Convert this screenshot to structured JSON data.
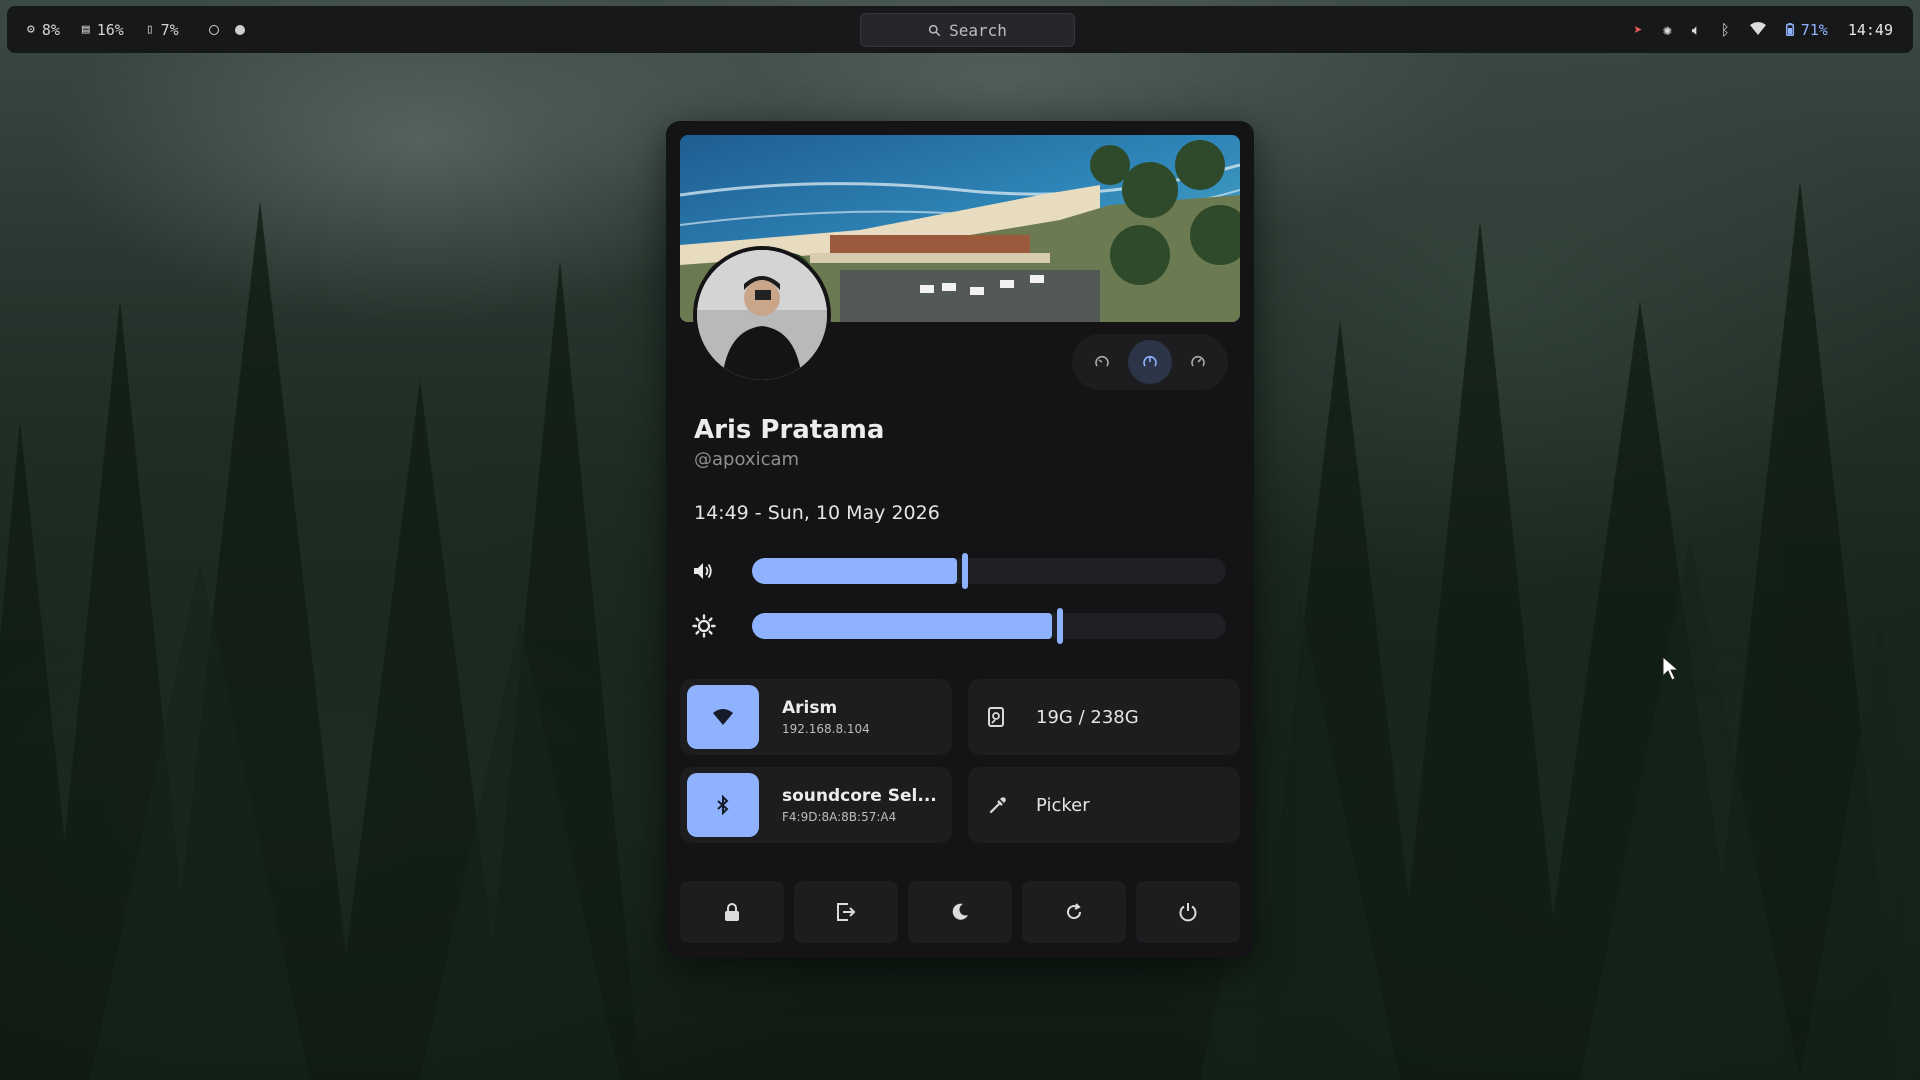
{
  "topbar": {
    "cpu": "8%",
    "ram": "16%",
    "disk": "7%",
    "search_label": "Search",
    "battery": "71%",
    "clock": "14:49"
  },
  "panel": {
    "user_name": "Aris Pratama",
    "user_handle": "@apoxicam",
    "datetime": "14:49 - Sun, 10 May 2026",
    "volume_level": 0.45,
    "brightness_level": 0.65,
    "wifi": {
      "name": "Arism",
      "detail": "192.168.8.104"
    },
    "storage": {
      "label": "19G / 238G"
    },
    "bluetooth": {
      "name": "soundcore Sel...",
      "detail": "F4:9D:8A:8B:57:A4"
    },
    "picker": {
      "label": "Picker"
    }
  },
  "colors": {
    "accent": "#8fb2ff",
    "panel_bg": "#141416",
    "tile_bg": "#1d1d20",
    "bar_bg": "#17181a"
  },
  "icons": {
    "cpu": "cpu-icon",
    "ram": "ram-icon",
    "disk": "disk-icon",
    "tray": [
      "send-icon",
      "sun-icon",
      "volume-icon",
      "bluetooth-icon",
      "wifi-icon",
      "battery-icon"
    ],
    "modes": [
      "power-saver-icon",
      "balanced-icon",
      "performance-icon"
    ],
    "power": [
      "lock-icon",
      "logout-icon",
      "sleep-icon",
      "reboot-icon",
      "power-icon"
    ]
  }
}
